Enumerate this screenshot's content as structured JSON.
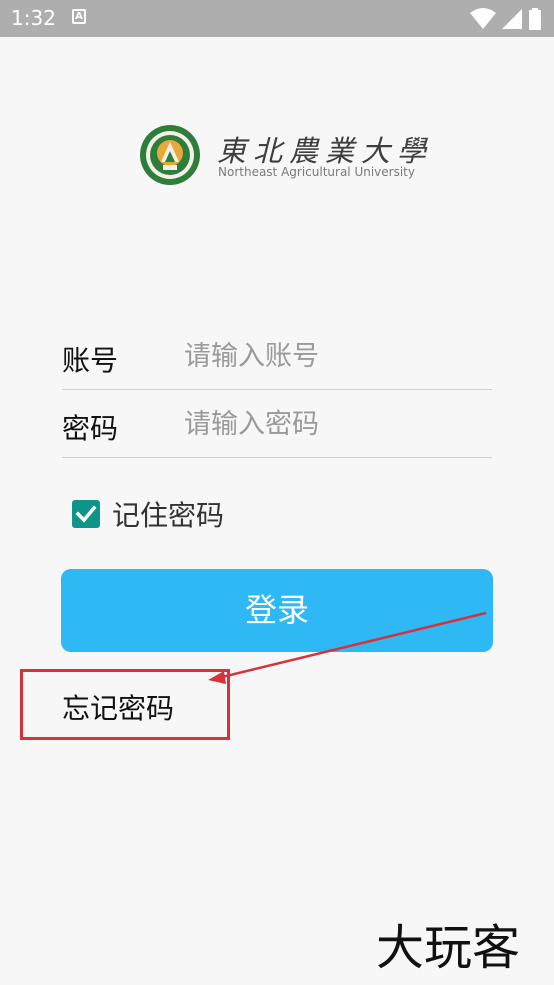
{
  "status_bar": {
    "time": "1:32",
    "notification_icon": "A"
  },
  "logo": {
    "chinese_name": "東北農業大學",
    "english_name": "Northeast Agricultural University"
  },
  "form": {
    "account": {
      "label": "账号",
      "placeholder": "请输入账号",
      "value": ""
    },
    "password": {
      "label": "密码",
      "placeholder": "请输入密码",
      "value": ""
    },
    "remember": {
      "label": "记住密码",
      "checked": true
    },
    "login_label": "登录",
    "forgot_label": "忘记密码"
  },
  "colors": {
    "accent_button": "#2eb8f4",
    "checkbox": "#0e9589",
    "annotation": "#d6323a",
    "status_bar": "#aeaeae"
  },
  "icons": [
    "wifi-icon",
    "signal-icon",
    "battery-icon",
    "checkmark-icon",
    "university-seal-icon",
    "annotation-arrow-icon"
  ],
  "watermark": "大玩客"
}
